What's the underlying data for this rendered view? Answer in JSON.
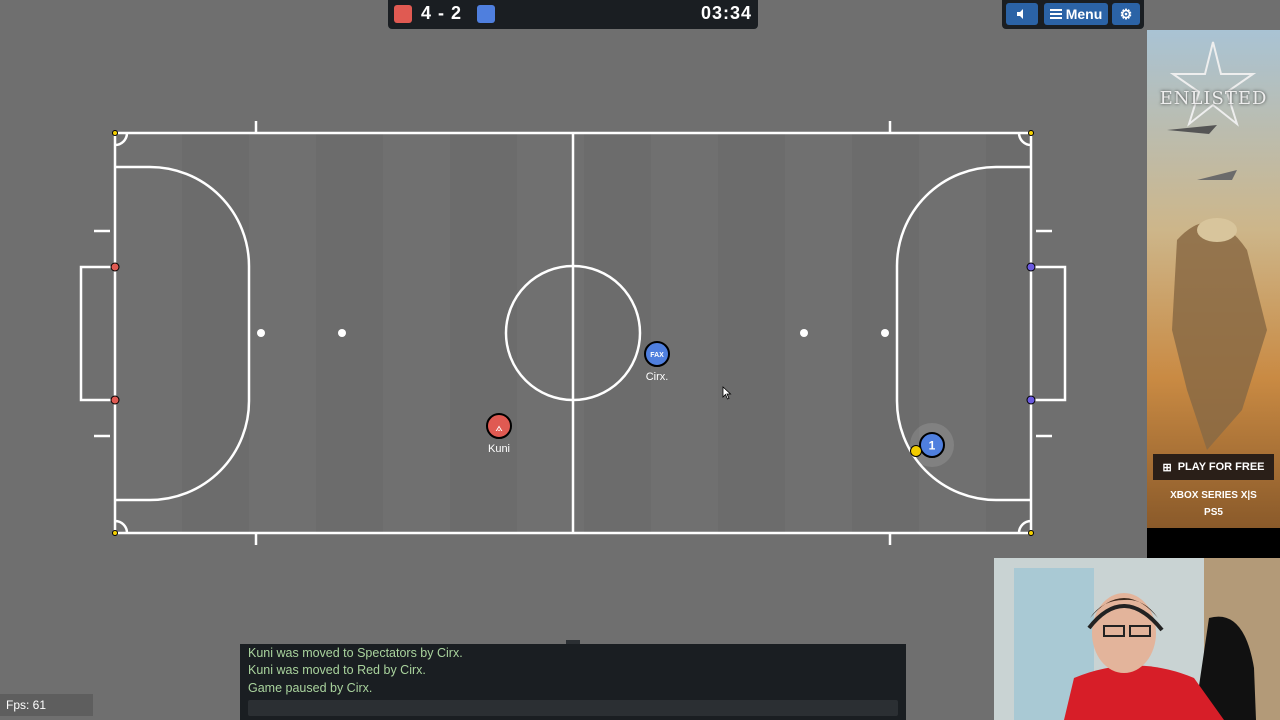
{
  "scoreboard": {
    "score": "4 - 2",
    "timer": "03:34",
    "red_color": "#e05a52",
    "blue_color": "#4f7fde"
  },
  "controls": {
    "menu_label": "Menu",
    "sound_icon": "speaker-icon",
    "settings_icon": "gear-icon"
  },
  "players": [
    {
      "name": "Kuni",
      "avatar": "⟑",
      "team": "red"
    },
    {
      "name": "Cirx.",
      "avatar": "FAX",
      "team": "blue"
    },
    {
      "name": "",
      "avatar": "1",
      "team": "blue"
    }
  ],
  "chat": {
    "lines": [
      "Kuni was moved to Spectators by Cirx.",
      "Kuni was moved to Red by Cirx.",
      "Game paused by Cirx."
    ]
  },
  "fps": "Fps: 61",
  "ad": {
    "logo": "ENLISTED",
    "cta": "PLAY FOR FREE",
    "platform1": "XBOX SERIES X|S",
    "platform2": "PS5"
  }
}
